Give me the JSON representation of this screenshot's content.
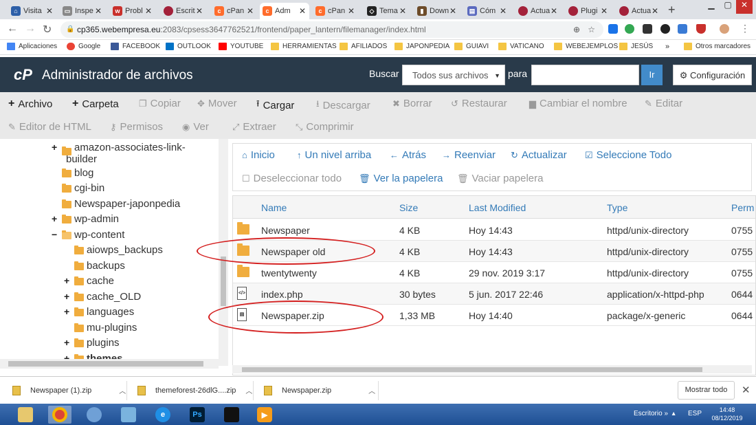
{
  "browser": {
    "tabs": [
      {
        "label": "Visita",
        "icon": "home-icon",
        "color": "#2d5fa8"
      },
      {
        "label": "Inspe",
        "icon": "page-icon",
        "color": "#888888"
      },
      {
        "label": "Probl",
        "icon": "ww-icon",
        "color": "#c9302c"
      },
      {
        "label": "Escrit",
        "icon": "avatar-icon",
        "color": "#a3213a"
      },
      {
        "label": "cPan",
        "icon": "cpanel-icon",
        "color": "#ff6c2c"
      },
      {
        "label": "Adm",
        "icon": "cpanel-icon",
        "color": "#ff6c2c",
        "active": true
      },
      {
        "label": "cPan",
        "icon": "cpanel-icon",
        "color": "#ff6c2c"
      },
      {
        "label": "Tema",
        "icon": "diamond-icon",
        "color": "#222222"
      },
      {
        "label": "Down",
        "icon": "download-icon",
        "color": "#6d4c2a"
      },
      {
        "label": "Cóm",
        "icon": "book-icon",
        "color": "#5b6abf"
      },
      {
        "label": "Actua",
        "icon": "avatar-icon",
        "color": "#a3213a"
      },
      {
        "label": "Plugi",
        "icon": "avatar-icon",
        "color": "#a3213a"
      },
      {
        "label": "Actua",
        "icon": "avatar-icon",
        "color": "#a3213a"
      }
    ],
    "url_host": "cp365.webempresa.eu",
    "url_path": ":2083/cpsess3647762521/frontend/paper_lantern/filemanager/index.html",
    "bookmarks": [
      {
        "label": "Aplicaciones",
        "color": "#4285f4"
      },
      {
        "label": "Google",
        "color": "#ea4335"
      },
      {
        "label": "FACEBOOK",
        "color": "#3b5998"
      },
      {
        "label": "OUTLOOK",
        "color": "#0072c6"
      },
      {
        "label": "YOUTUBE",
        "color": "#ff0000"
      },
      {
        "label": "HERRAMIENTAS",
        "color": "#f4c542"
      },
      {
        "label": "AFILIADOS",
        "color": "#f4c542"
      },
      {
        "label": "JAPONPEDIA",
        "color": "#f4c542"
      },
      {
        "label": "GUIAVI",
        "color": "#f4c542"
      },
      {
        "label": "VATICANO",
        "color": "#f4c542"
      },
      {
        "label": "WEBEJEMPLOS",
        "color": "#f4c542"
      },
      {
        "label": "JESÚS",
        "color": "#f4c542"
      }
    ],
    "bookmarks_more": "»",
    "other_bookmarks": "Otros marcadores"
  },
  "header": {
    "logo": "cP",
    "title": "Administrador de archivos",
    "search_label": "Buscar",
    "search_scope": "Todos sus archivos",
    "para_label": "para",
    "go_label": "Ir",
    "settings_label": "Configuración"
  },
  "toolbar": {
    "archivo": "Archivo",
    "carpeta": "Carpeta",
    "copiar": "Copiar",
    "mover": "Mover",
    "cargar": "Cargar",
    "descargar": "Descargar",
    "borrar": "Borrar",
    "restaurar": "Restaurar",
    "cambiar_nombre": "Cambiar el nombre",
    "editar": "Editar",
    "editor_html": "Editor de HTML",
    "permisos": "Permisos",
    "ver": "Ver",
    "extraer": "Extraer",
    "comprimir": "Comprimir"
  },
  "tree": {
    "n0a": "amazon-associates-link-",
    "n0b": "builder",
    "n1": "blog",
    "n2": "cgi-bin",
    "n3": "Newspaper-japonpedia",
    "n4": "wp-admin",
    "n5": "wp-content",
    "n6": "aiowps_backups",
    "n7": "backups",
    "n8": "cache",
    "n9": "cache_OLD",
    "n10": "languages",
    "n11": "mu-plugins",
    "n12": "plugins",
    "n13": "themes"
  },
  "nav": {
    "inicio": "Inicio",
    "arriba": "Un nivel arriba",
    "atras": "Atrás",
    "reenviar": "Reenviar",
    "actualizar": "Actualizar",
    "sel_todo": "Seleccione Todo",
    "desel_todo": "Deseleccionar todo",
    "ver_papelera": "Ver la papelera",
    "vaciar_papelera": "Vaciar papelera"
  },
  "files": {
    "columns": {
      "name": "Name",
      "size": "Size",
      "modified": "Last Modified",
      "type": "Type",
      "perms": "Perm"
    },
    "rows": [
      {
        "name": "Newspaper",
        "size": "4 KB",
        "modified": "Hoy 14:43",
        "type": "httpd/unix-directory",
        "perms": "0755"
      },
      {
        "name": "Newspaper old",
        "size": "4 KB",
        "modified": "Hoy 14:43",
        "type": "httpd/unix-directory",
        "perms": "0755"
      },
      {
        "name": "twentytwenty",
        "size": "4 KB",
        "modified": "29 nov. 2019 3:17",
        "type": "httpd/unix-directory",
        "perms": "0755"
      },
      {
        "name": "index.php",
        "size": "30 bytes",
        "modified": "5 jun. 2017 22:46",
        "type": "application/x-httpd-php",
        "perms": "0644"
      },
      {
        "name": "Newspaper.zip",
        "size": "1,33 MB",
        "modified": "Hoy 14:40",
        "type": "package/x-generic",
        "perms": "0644"
      }
    ]
  },
  "downloads": {
    "items": [
      "Newspaper (1).zip",
      "themeforest-26dlG....zip",
      "Newspaper.zip"
    ],
    "show_all": "Mostrar todo"
  },
  "taskbar": {
    "tray_label": "Escritorio",
    "lang": "ESP",
    "time": "14:48",
    "date": "08/12/2019"
  }
}
